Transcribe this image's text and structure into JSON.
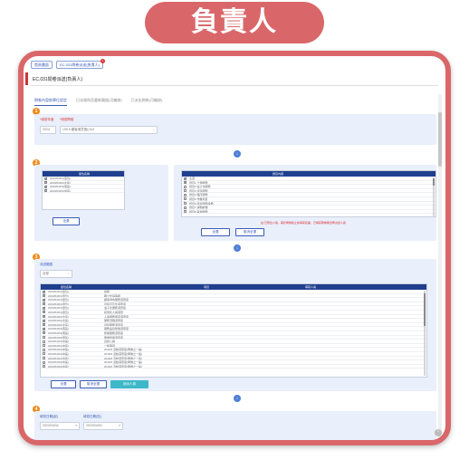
{
  "banner": {
    "title": "負責人"
  },
  "topbar": {
    "tabs": [
      {
        "label": "首頁畫面"
      },
      {
        "label": "EC.031問卷派送(負責人)"
      }
    ],
    "badge": "1"
  },
  "page": {
    "title": "EC.031問卷派送(負責人)"
  },
  "tabs": [
    {
      "label": "問卷內容依單位設定"
    },
    {
      "label": "已派發與否重新開放(可編修)"
    },
    {
      "label": "已派出問卷(可編修)"
    }
  ],
  "section1": {
    "step": "1",
    "label_year": "*填寫年度",
    "label_survey": "*填寫問卷",
    "year_value": "2024",
    "survey_value": "109.6 顧客滿意度(小)3"
  },
  "section2": {
    "step": "2",
    "left_header": "單位名稱",
    "left_rows": [
      {
        "text": "2023/04/01(單位)",
        "checked": true
      },
      {
        "text": "2023/04/02(北區)",
        "checked": true
      },
      {
        "text": "2023/04/03(南區)",
        "checked": true
      },
      {
        "text": "2023/04/04(中區)",
        "checked": true
      }
    ],
    "left_button": "全選",
    "right_header": "題目內容",
    "right_rows": [
      {
        "text": "全選",
        "checked": true
      },
      {
        "text": "題目1 十類服務",
        "checked": true
      },
      {
        "text": "題目2 電子化服務",
        "checked": false
      },
      {
        "text": "題目3 資訊服務",
        "checked": false
      },
      {
        "text": "題目4 程序服務",
        "checked": false
      },
      {
        "text": "題目5 作業項目",
        "checked": false
      },
      {
        "text": "題目6 環境服務設備",
        "checked": false
      },
      {
        "text": "題目7 訴願處理",
        "checked": false
      },
      {
        "text": "題目8 其他服務",
        "checked": false
      }
    ],
    "right_buttons": [
      "全選",
      "取消全選"
    ],
    "hint": "註:已發出人員，需於問卷截止前填寫完畢，已填寫問卷無法再派送人員"
  },
  "section3": {
    "step": "3",
    "label_scope": "派送範圍",
    "scope_value": "全部",
    "col_unit": "單位名稱",
    "col_item": "項目",
    "col_owner": "填寫人員",
    "rows": [
      {
        "unit": "2023/04/01(單位)",
        "item": "總務",
        "checked": true
      },
      {
        "text_unit": "",
        "unit": "2023/04/01(單位)",
        "item": "獨立性與客觀",
        "checked": true
      },
      {
        "unit": "2023/04/01(單位)",
        "item": "顧客導向服務滿意度",
        "checked": true
      },
      {
        "unit": "2023/04/01(單位)",
        "item": "資訊可及性滿意度",
        "checked": true
      },
      {
        "unit": "2023/04/01(單位)",
        "item": "電子化服務滿意度",
        "checked": true
      },
      {
        "unit": "2023/04/01(單位)",
        "item": "對受託人員滿意",
        "checked": true
      },
      {
        "unit": "2023/04/02(北區)",
        "item": "人員服務態度滿意度",
        "checked": true
      },
      {
        "unit": "2023/04/02(北區)",
        "item": "服務流程滿意度",
        "checked": true
      },
      {
        "unit": "2023/04/02(北區)",
        "item": "資訊服務滿意度",
        "checked": true
      },
      {
        "unit": "2023/04/03(南區)",
        "item": "服務品質整體滿意度",
        "checked": true
      },
      {
        "unit": "2023/04/03(南區)",
        "item": "整體服務滿意度",
        "checked": true
      },
      {
        "unit": "2023/04/03(南區)",
        "item": "問卷整體滿意度",
        "checked": false
      },
      {
        "unit": "2023/04/04(中區)",
        "item": "資訊公開",
        "checked": false
      },
      {
        "unit": "2023/04/04(中區)",
        "item": "一般事項",
        "checked": false
      },
      {
        "unit": "2023/04/04(中區)",
        "item": "2019/3 活動滿意度(問卷之一般)",
        "checked": false
      },
      {
        "unit": "2023/04/04(中區)",
        "item": "2019/3 活動滿意度(問卷之一般)",
        "checked": false
      },
      {
        "unit": "2023/04/04(中區)",
        "item": "2019/3 活動滿意度(問卷之一般)",
        "checked": false
      },
      {
        "unit": "2023/04/04(中區)",
        "item": "2019/3 活動滿意度(問卷之一般)",
        "checked": false
      },
      {
        "unit": "2023/04/04(中區)",
        "item": "2019/3 活動滿意度(問卷之一般)",
        "checked": false
      }
    ],
    "buttons": [
      "全選",
      "取消全選",
      "指派人員"
    ]
  },
  "section4": {
    "step": "4",
    "label_start": "填寫日期(起)",
    "label_end": "填寫日期(迄)",
    "start_value": "2023/04/04",
    "end_value": "2023/04/30"
  }
}
